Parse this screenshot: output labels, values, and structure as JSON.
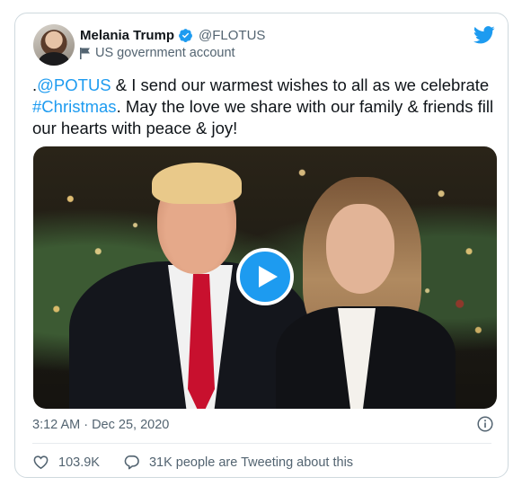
{
  "author": {
    "display_name": "Melania Trump",
    "handle": "@FLOTUS",
    "account_label": "US government account",
    "verified": true
  },
  "tweet": {
    "segments": [
      {
        "text": ".",
        "link": false
      },
      {
        "text": "@POTUS",
        "link": true
      },
      {
        "text": " & I send our warmest wishes to all as we celebrate ",
        "link": false
      },
      {
        "text": "#Christmas",
        "link": true
      },
      {
        "text": ". May the love we share with our family & friends fill our hearts with peace & joy!",
        "link": false
      }
    ]
  },
  "media": {
    "type": "video"
  },
  "meta": {
    "timestamp": "3:12 AM · Dec 25, 2020"
  },
  "actions": {
    "likes": "103.9K",
    "conversation": "31K people are Tweeting about this"
  },
  "colors": {
    "accent": "#1d9bf0",
    "text": "#0f1419",
    "secondary": "#536471",
    "border": "#cfd9de"
  },
  "icons": [
    "verified-badge-icon",
    "government-flag-icon",
    "twitter-bird-icon",
    "play-icon",
    "info-icon",
    "heart-icon",
    "conversation-icon"
  ]
}
